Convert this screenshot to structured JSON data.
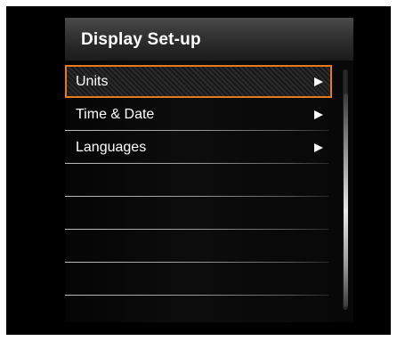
{
  "header": {
    "title": "Display Set-up"
  },
  "menu": {
    "items": [
      {
        "label": "Units",
        "selected": true,
        "has_submenu": true
      },
      {
        "label": "Time & Date",
        "selected": false,
        "has_submenu": true
      },
      {
        "label": "Languages",
        "selected": false,
        "has_submenu": true
      },
      {
        "label": "",
        "selected": false,
        "has_submenu": false
      },
      {
        "label": "",
        "selected": false,
        "has_submenu": false
      },
      {
        "label": "",
        "selected": false,
        "has_submenu": false
      },
      {
        "label": "",
        "selected": false,
        "has_submenu": false
      }
    ]
  },
  "colors": {
    "selection_border": "#e37a1c",
    "text": "#ffffff",
    "background": "#000000"
  },
  "icons": {
    "submenu_arrow": "right-triangle-icon"
  }
}
